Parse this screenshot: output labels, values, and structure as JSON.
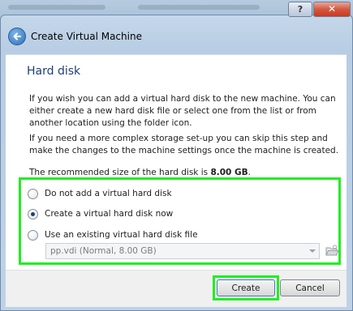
{
  "window": {
    "title": "Create Virtual Machine",
    "help_label": "?",
    "close_label": "✕"
  },
  "page": {
    "heading": "Hard disk",
    "paragraph1": "If you wish you can add a virtual hard disk to the new machine. You can either create a new hard disk file or select one from the list or from another location using the folder icon.",
    "paragraph2": "If you need a more complex storage set-up you can skip this step and make the changes to the machine settings once the machine is created.",
    "recommended_prefix": "The recommended size of the hard disk is ",
    "recommended_size": "8.00 GB",
    "recommended_suffix": "."
  },
  "options": [
    {
      "label": "Do not add a virtual hard disk",
      "selected": false
    },
    {
      "label": "Create a virtual hard disk now",
      "selected": true
    },
    {
      "label": "Use an existing virtual hard disk file",
      "selected": false
    }
  ],
  "existing_disk_select": {
    "value": "pp.vdi (Normal, 8.00 GB)",
    "disabled": true
  },
  "buttons": {
    "create": "Create",
    "cancel": "Cancel"
  },
  "icons": {
    "back": "back-arrow-icon",
    "folder": "folder-open-icon",
    "dropdown": "chevron-down-icon"
  },
  "colors": {
    "highlight": "#22ee22",
    "heading": "#1d3f78"
  }
}
